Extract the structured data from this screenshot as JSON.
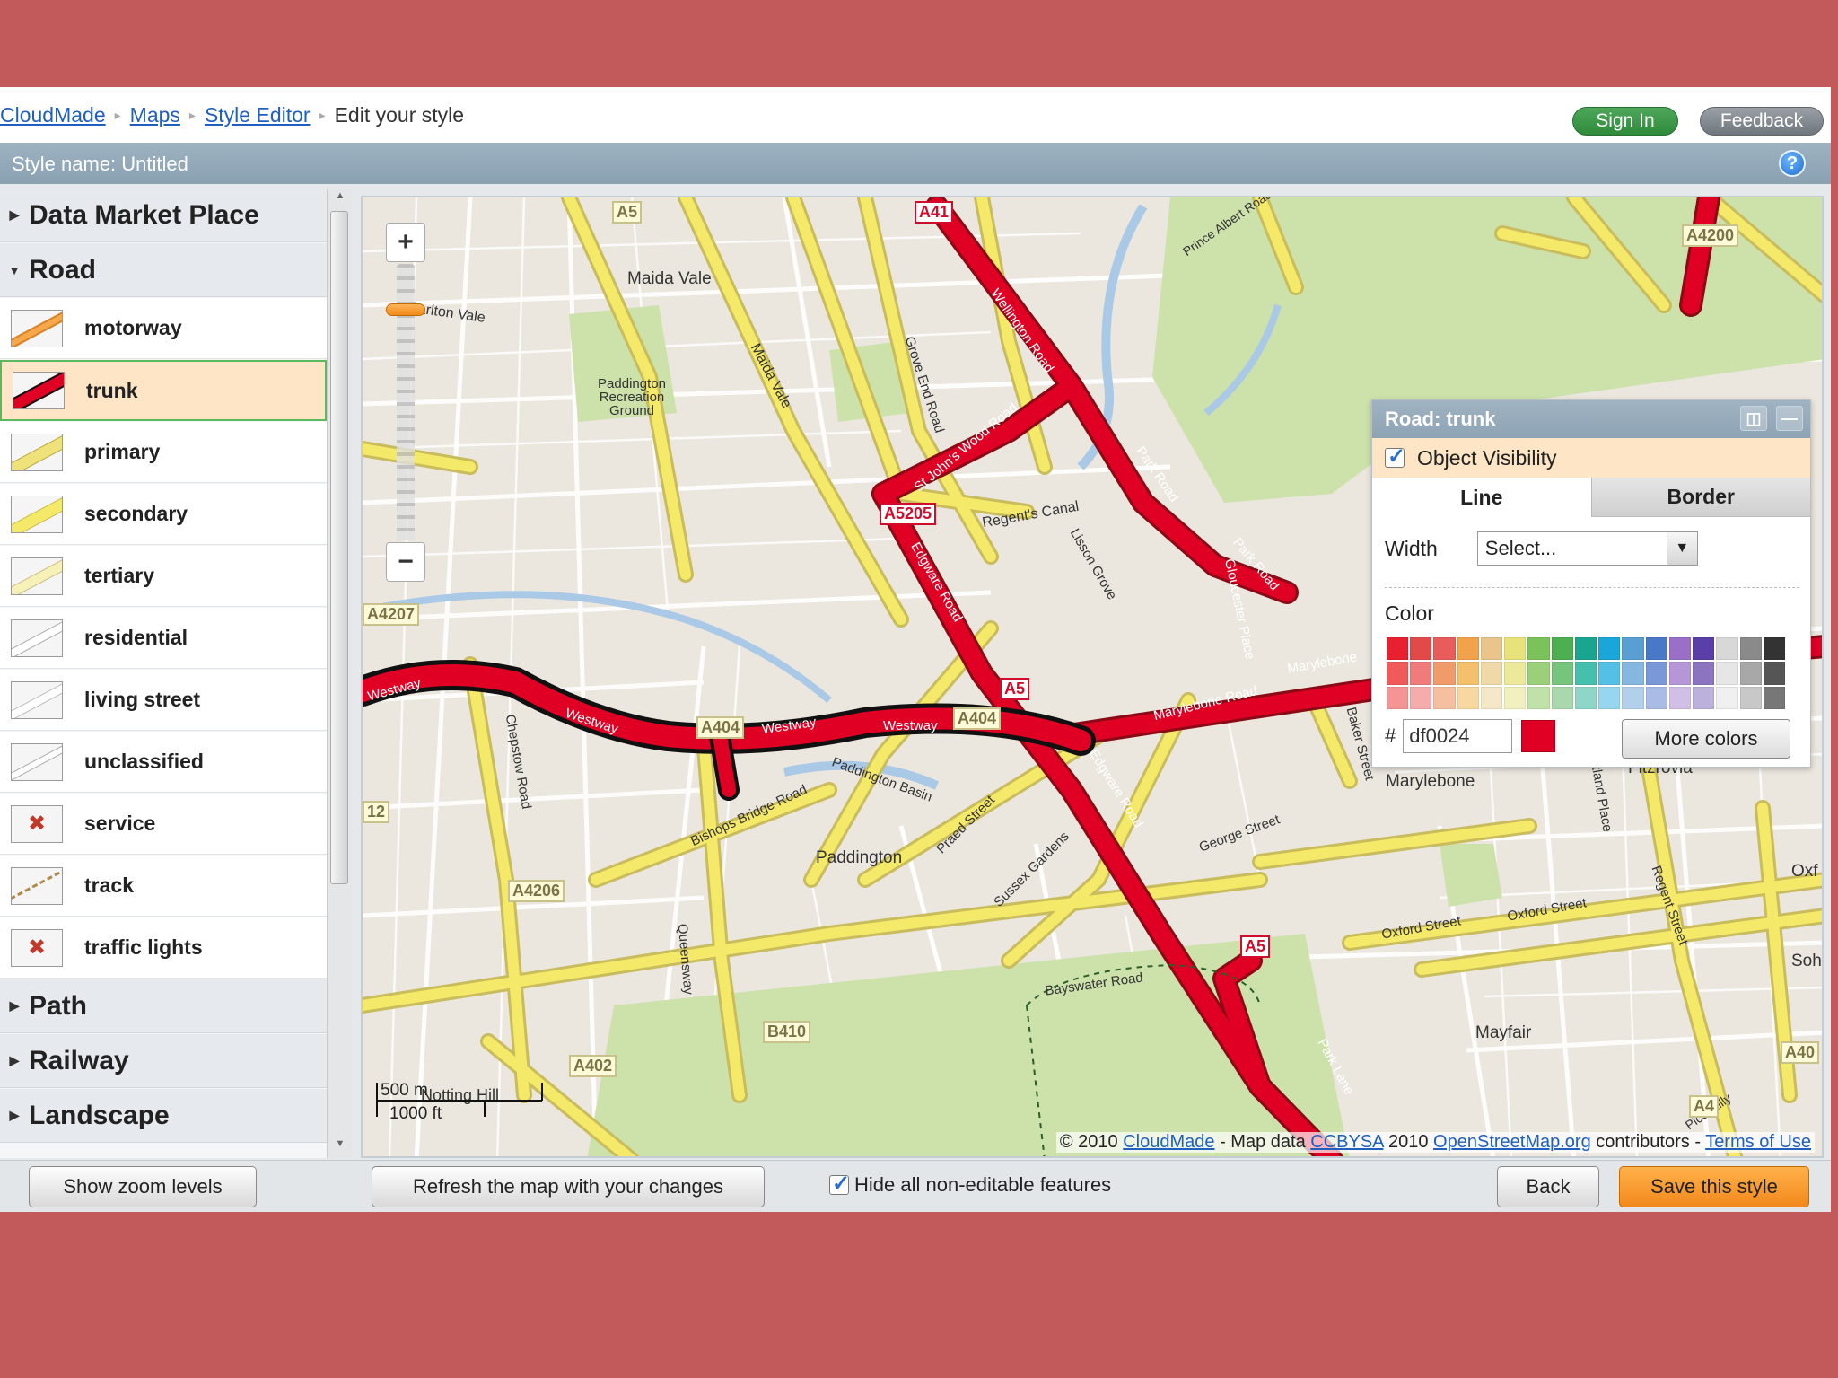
{
  "breadcrumb": {
    "items": [
      "CloudMade",
      "Maps",
      "Style Editor"
    ],
    "current": "Edit your style"
  },
  "header": {
    "sign_in": "Sign In",
    "feedback": "Feedback"
  },
  "style_bar": {
    "name": "Style name: Untitled",
    "help": "?"
  },
  "sidebar": {
    "categories": [
      {
        "label": "Data Market Place",
        "expanded": false
      },
      {
        "label": "Road",
        "expanded": true
      },
      {
        "label": "Path",
        "expanded": false
      },
      {
        "label": "Railway",
        "expanded": false
      },
      {
        "label": "Landscape",
        "expanded": false
      }
    ],
    "road_items": [
      {
        "label": "motorway",
        "color": "#f7a84a"
      },
      {
        "label": "trunk",
        "color": "#df0024",
        "selected": true
      },
      {
        "label": "primary",
        "color": "#f0e27a"
      },
      {
        "label": "secondary",
        "color": "#f5e96a"
      },
      {
        "label": "tertiary",
        "color": "#f7f1b8"
      },
      {
        "label": "residential",
        "color": "#ffffff"
      },
      {
        "label": "living street",
        "color": "#ffffff"
      },
      {
        "label": "unclassified",
        "color": "#ffffff"
      },
      {
        "label": "service",
        "icon": "service-icon"
      },
      {
        "label": "track",
        "icon": "track-icon"
      },
      {
        "label": "traffic lights",
        "icon": "traffic-lights-icon"
      }
    ]
  },
  "map": {
    "labels": [
      "Maida Vale",
      "Carlton Vale",
      "Paddington Recreation Ground",
      "Maida Vale",
      "Grove End Road",
      "Wellington Road",
      "St John's Wood Road",
      "Park Road",
      "Regent's Canal",
      "Lisson Grove",
      "Gloucester Place",
      "Park Road",
      "Marylebone Road",
      "Marylebone",
      "Westway",
      "Westway",
      "Westway",
      "Westway",
      "Edgware Road",
      "Edgware Road",
      "Chepstow Road",
      "Bishops Bridge Road",
      "Paddington Basin",
      "Praed Street",
      "Paddington",
      "Sussex Gardens",
      "George Street",
      "Baker Street",
      "Marylebone",
      "Fitzrovia",
      "Oxford Street",
      "Oxford Street",
      "Regent Street",
      "Bayswater Road",
      "Park Lane",
      "Queensway",
      "Mayfair",
      "Notting Hill",
      "Prince Albert Road",
      "Portland Place",
      "Soh",
      "Oxf",
      "Piccadilly"
    ],
    "shields": [
      {
        "text": "A41",
        "kind": "trunk"
      },
      {
        "text": "A5",
        "kind": "primary"
      },
      {
        "text": "A4200",
        "kind": "primary"
      },
      {
        "text": "A5205",
        "kind": "trunk"
      },
      {
        "text": "A4207",
        "kind": "primary"
      },
      {
        "text": "A5",
        "kind": "trunk"
      },
      {
        "text": "A404",
        "kind": "primary"
      },
      {
        "text": "A404",
        "kind": "primary"
      },
      {
        "text": "A4206",
        "kind": "primary"
      },
      {
        "text": "12",
        "kind": "primary"
      },
      {
        "text": "A5",
        "kind": "trunk"
      },
      {
        "text": "B410",
        "kind": "primary"
      },
      {
        "text": "A402",
        "kind": "primary"
      },
      {
        "text": "A40",
        "kind": "primary"
      },
      {
        "text": "A4",
        "kind": "primary"
      }
    ],
    "scale": {
      "metric": "500 m",
      "imperial": "1000 ft"
    },
    "attribution": {
      "prefix": "© 2010",
      "cloudmade": "CloudMade",
      "mid": "- Map data",
      "license": "CCBYSA",
      "year": "2010",
      "osm": "OpenStreetMap.org",
      "contributors": "contributors -",
      "terms": "Terms of Use"
    }
  },
  "panel": {
    "title": "Road: trunk",
    "visibility": "Object Visibility",
    "tabs": [
      "Line",
      "Border"
    ],
    "width_label": "Width",
    "width_value": "Select...",
    "color_label": "Color",
    "hex_prefix": "#",
    "hex_value": "df0024",
    "more_colors": "More colors",
    "palette": [
      "#e8202f",
      "#e24a4a",
      "#e85c5c",
      "#f2a24a",
      "#e9c58b",
      "#e7e27a",
      "#7bc25a",
      "#4caf50",
      "#19a58f",
      "#1aa6d9",
      "#5a9fd4",
      "#4a78c8",
      "#9a6fc8",
      "#5b3fa8",
      "#d8d8d8",
      "#8a8a8a",
      "#333333",
      "#f15a5a",
      "#ef7b7b",
      "#f29b6a",
      "#f5c06b",
      "#f0d9a8",
      "#ede99a",
      "#9bd07a",
      "#77c47c",
      "#45c0ad",
      "#55c0e6",
      "#86b7e0",
      "#7a98d8",
      "#b796d8",
      "#8c74c0",
      "#e6e6e6",
      "#a8a8a8",
      "#555555",
      "#f59494",
      "#f4acac",
      "#f6c0a0",
      "#f8d8a0",
      "#f5e8c8",
      "#f3f0c0",
      "#c0e2a8",
      "#a9d8ad",
      "#8fd6c9",
      "#96d6ef",
      "#b2d0ec",
      "#aabce6",
      "#d2bfe6",
      "#bcb0dc",
      "#f0f0f0",
      "#c8c8c8",
      "#777777"
    ]
  },
  "bottom": {
    "show_zoom": "Show zoom levels",
    "refresh": "Refresh the map with your changes",
    "hide_label": "Hide all non-editable features",
    "back": "Back",
    "save": "Save this style"
  },
  "colors": {
    "trunk": "#df0024",
    "primary": "#f5e96a",
    "park": "#c8dfa4",
    "water": "#a9c9e6",
    "accent_orange": "#f2891c"
  }
}
